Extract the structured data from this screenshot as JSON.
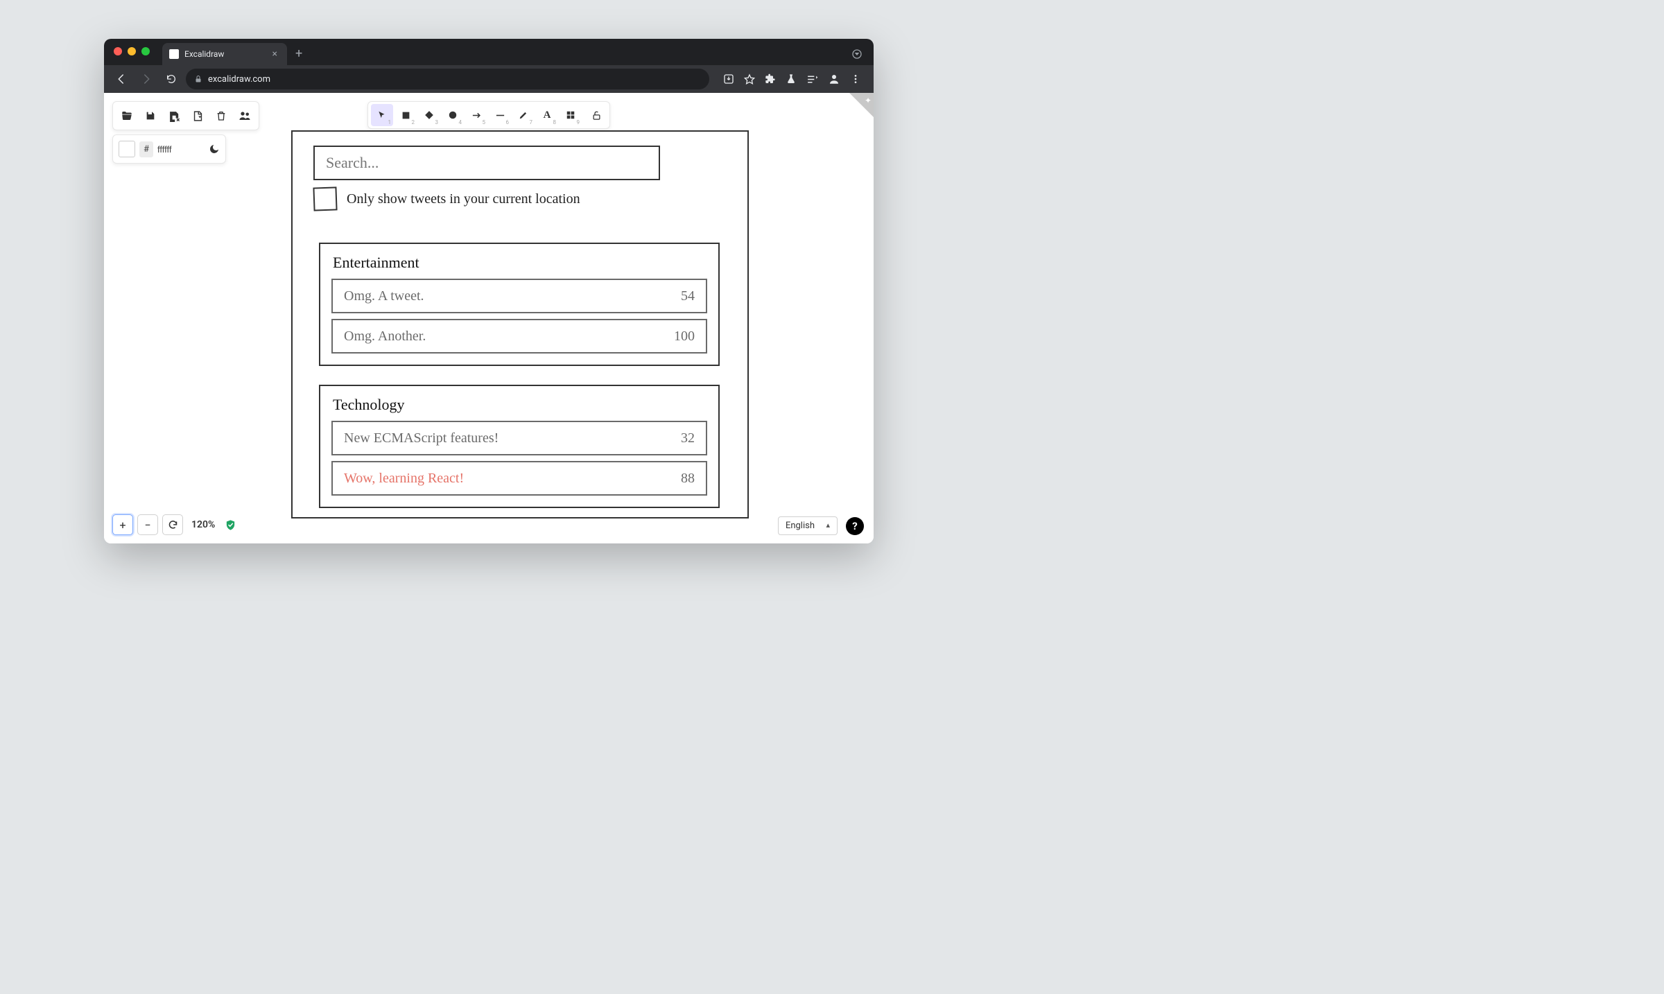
{
  "browser": {
    "tab_title": "Excalidraw",
    "url": "excalidraw.com"
  },
  "excalidraw": {
    "background_hex_prefix": "#",
    "background_hex": "ffffff",
    "shape_numbers": [
      "1",
      "2",
      "3",
      "4",
      "5",
      "6",
      "7",
      "8",
      "9"
    ],
    "zoom": {
      "level_text": "120%"
    },
    "language": "English"
  },
  "canvas": {
    "search_placeholder": "Search...",
    "location_filter_label": "Only show tweets in your current location",
    "groups": [
      {
        "title": "Entertainment",
        "tweets": [
          {
            "text": "Omg. A tweet.",
            "count": "54",
            "highlight": false
          },
          {
            "text": "Omg. Another.",
            "count": "100",
            "highlight": false
          }
        ]
      },
      {
        "title": "Technology",
        "tweets": [
          {
            "text": "New ECMAScript features!",
            "count": "32",
            "highlight": false
          },
          {
            "text": "Wow, learning React!",
            "count": "88",
            "highlight": true
          }
        ]
      }
    ]
  }
}
